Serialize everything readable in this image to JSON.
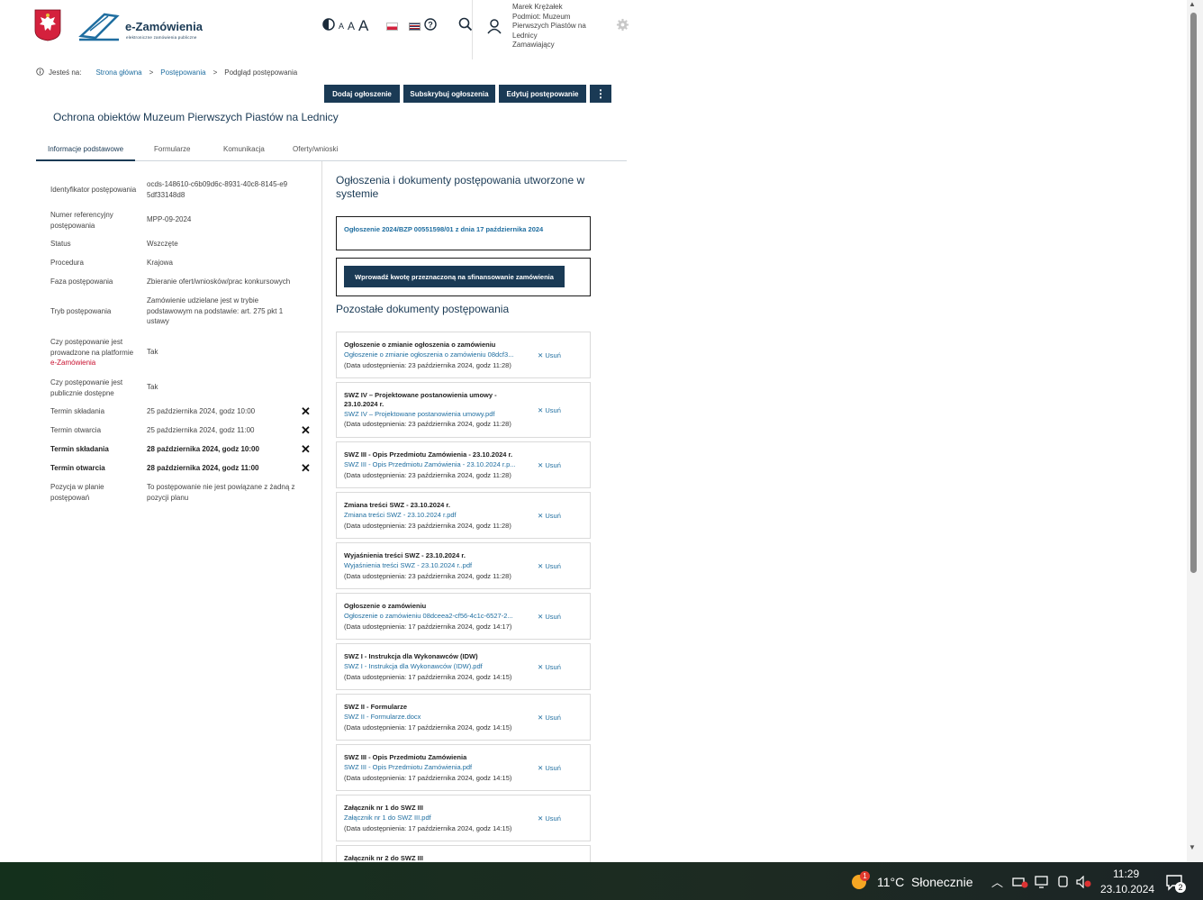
{
  "header": {
    "brand_title": "e-Zamówienia",
    "brand_subtitle": "elektroniczne zamówienia publiczne",
    "contrast_icon": "contrast-icon",
    "font_small": "A",
    "font_mid": "A",
    "font_large": "A",
    "user": {
      "name": "Marek Krężałek",
      "entity": "Podmiot: Muzeum Pierwszych Piastów na Lednicy",
      "role": "Zamawiający"
    }
  },
  "breadcrumb": {
    "prefix": "Jesteś na:",
    "items": [
      "Strona główna",
      "Postępowania",
      "Podgląd postępowania"
    ],
    "separator": ">"
  },
  "actions": {
    "add": "Dodaj ogłoszenie",
    "subscribe": "Subskrybuj ogłoszenia",
    "edit": "Edytuj postępowanie",
    "more": "⋮"
  },
  "page_title": "Ochrona obiektów Muzeum Pierwszych Piastów na Lednicy",
  "tabs": [
    "Informacje podstawowe",
    "Formularze",
    "Komunikacja",
    "Oferty/wnioski"
  ],
  "info": [
    {
      "label": "Identyfikator postępowania",
      "value": "ocds-148610-c6b09d6c-8931-40c8-8145-e95df33148d8"
    },
    {
      "label": "Numer referencyjny postępowania",
      "value": "MPP-09-2024"
    },
    {
      "label": "Status",
      "value": "Wszczęte"
    },
    {
      "label": "Procedura",
      "value": "Krajowa"
    },
    {
      "label": "Faza postępowania",
      "value": "Zbieranie ofert/wniosków/prac konkursowych"
    },
    {
      "label": "Tryb postępowania",
      "value": "Zamówienie udzielane jest w trybie podstawowym na podstawie: art. 275 pkt 1 ustawy"
    },
    {
      "label_a": "Czy postępowanie jest prowadzone na platformie ",
      "label_b": "e-Zamówienia",
      "value": "Tak"
    },
    {
      "label": "Czy postępowanie jest publicznie dostępne",
      "value": "Tak"
    },
    {
      "label": "Termin składania",
      "value": "25 października 2024, godz 10:00"
    },
    {
      "label": "Termin otwarcia",
      "value": "25 października 2024, godz 11:00"
    },
    {
      "label": "Termin składania",
      "value": "28 października 2024, godz 10:00"
    },
    {
      "label": "Termin otwarcia",
      "value": "28 października 2024, godz 11:00"
    },
    {
      "label": "Pozycja w planie postępowań",
      "value": "To postępowanie nie jest powiązane z żadną z pozycji planu"
    }
  ],
  "right": {
    "heading": "Ogłoszenia i dokumenty postępowania utworzone w systemie",
    "notice_link": "Ogłoszenie 2024/BZP 00551598/01 z dnia 17 października 2024",
    "amount_button": "Wprowadź kwotę przeznaczoną na sfinansowanie zamówienia",
    "other_heading": "Pozostałe dokumenty postępowania",
    "delete_label": "Usuń",
    "docs": [
      {
        "title": "Ogłoszenie o zmianie ogłoszenia o zamówieniu",
        "file": "Ogłoszenie o zmianie ogłoszenia o zamówieniu 08dcf3...",
        "date": "(Data udostępnienia: 23 października 2024, godz 11:28)"
      },
      {
        "title": "SWZ IV – Projektowane postanowienia umowy - 23.10.2024 r.",
        "file": "SWZ IV – Projektowane postanowienia umowy.pdf",
        "date": "(Data udostępnienia: 23 października 2024, godz 11:28)"
      },
      {
        "title": "SWZ III - Opis Przedmiotu Zamówienia - 23.10.2024 r.",
        "file": "SWZ III - Opis Przedmiotu Zamówienia - 23.10.2024 r.p...",
        "date": "(Data udostępnienia: 23 października 2024, godz 11:28)"
      },
      {
        "title": "Zmiana treści SWZ - 23.10.2024 r.",
        "file": "Zmiana treści SWZ - 23.10.2024 r.pdf",
        "date": "(Data udostępnienia: 23 października 2024, godz 11:28)"
      },
      {
        "title": "Wyjaśnienia treści SWZ - 23.10.2024 r.",
        "file": "Wyjaśnienia treści SWZ - 23.10.2024 r..pdf",
        "date": "(Data udostępnienia: 23 października 2024, godz 11:28)"
      },
      {
        "title": "Ogłoszenie o zamówieniu",
        "file": "Ogłoszenie o zamówieniu 08dceea2-cf56-4c1c-6527-2...",
        "date": "(Data udostępnienia: 17 października 2024, godz 14:17)"
      },
      {
        "title": "SWZ I - Instrukcja dla Wykonawców (IDW)",
        "file": "SWZ I - Instrukcja dla Wykonawców (IDW).pdf",
        "date": "(Data udostępnienia: 17 października 2024, godz 14:15)"
      },
      {
        "title": "SWZ II - Formularze",
        "file": "SWZ II - Formularze.docx",
        "date": "(Data udostępnienia: 17 października 2024, godz 14:15)"
      },
      {
        "title": "SWZ III - Opis Przedmiotu Zamówienia",
        "file": "SWZ III - Opis Przedmiotu Zamówienia.pdf",
        "date": "(Data udostępnienia: 17 października 2024, godz 14:15)"
      },
      {
        "title": "Załącznik nr 1 do SWZ III",
        "file": "Załącznik nr 1 do SWZ III.pdf",
        "date": "(Data udostępnienia: 17 października 2024, godz 14:15)"
      },
      {
        "title": "Załącznik nr 2 do SWZ III",
        "file": "",
        "date": ""
      }
    ]
  },
  "taskbar": {
    "weather_badge": "1",
    "temperature": "11°C",
    "weather": "Słonecznie",
    "time": "11:29",
    "date": "23.10.2024",
    "notifications": "2"
  }
}
